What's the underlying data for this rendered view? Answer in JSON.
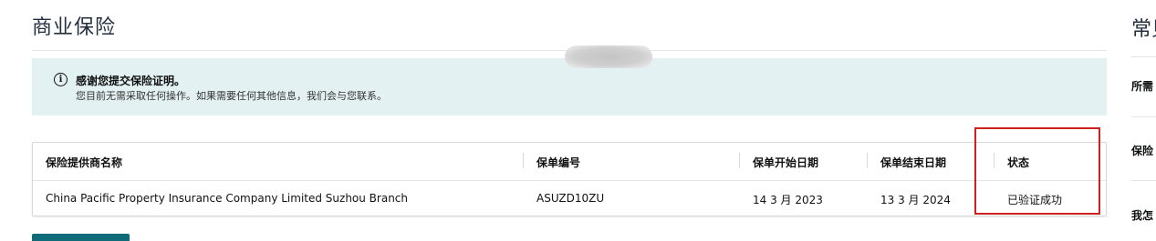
{
  "page": {
    "title": "商业保险"
  },
  "alert": {
    "icon": "info-icon",
    "title": "感谢您提交保险证明。",
    "body": "您目前无需采取任何操作。如果需要任何其他信息，我们会与您联系。"
  },
  "table": {
    "headers": {
      "provider": "保险提供商名称",
      "policy_number": "保单编号",
      "start_date": "保单开始日期",
      "end_date": "保单结束日期",
      "status": "状态"
    },
    "rows": [
      {
        "provider": "China Pacific Property Insurance Company Limited Suzhou Branch",
        "policy_number": "ASUZD10ZU",
        "start_date": "14 3 月 2023",
        "end_date": "13 3 月 2024",
        "status": "已验证成功"
      }
    ]
  },
  "sidebar": {
    "title": "常见",
    "items": [
      "所需",
      "保险",
      "我怎"
    ]
  },
  "colors": {
    "alert_bg": "#e4f1f3",
    "highlight": "#d21f1f",
    "primary_button": "#0e6b77"
  }
}
